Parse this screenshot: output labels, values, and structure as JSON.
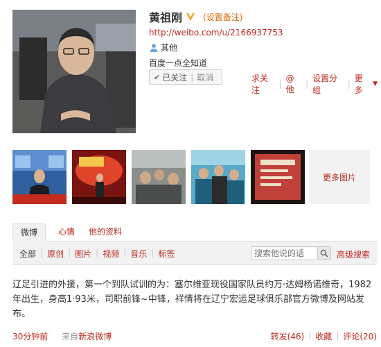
{
  "profile": {
    "name": "黄祖刚",
    "remark": "(设置备注)",
    "url": "http://weibo.com/u/2166937753",
    "location": "其他",
    "bio": "百度一点全知道",
    "follow": {
      "status": "已关注",
      "cancel": "取消"
    },
    "actions": [
      "求关注",
      "@他",
      "设置分组",
      "更多"
    ],
    "verified_color": "#f5a623"
  },
  "photos": {
    "more_label": "更多图片"
  },
  "tabs": [
    "微博",
    "心情",
    "他的资料"
  ],
  "filters": [
    "全部",
    "原创",
    "图片",
    "视频",
    "音乐",
    "标签"
  ],
  "search": {
    "placeholder": "搜索他说的话",
    "advanced_label": "高级搜索"
  },
  "post": {
    "text": "辽足引进的外援，第一个到队试训的为：塞尔维亚现役国家队员约万·达姆杨诺维奇，1982年出生，身高1·93米，司职前锋~中锋，祥情将在辽宁宏运足球俱乐部官方微博及网站发布。",
    "time": "30分钟前",
    "source_prefix": "来自",
    "source": "新浪微博",
    "repost": "转发(46)",
    "favorite": "收藏",
    "comment": "评论(20)"
  },
  "colors": {
    "link": "#c0281e",
    "accent_orange": "#e06c10"
  }
}
